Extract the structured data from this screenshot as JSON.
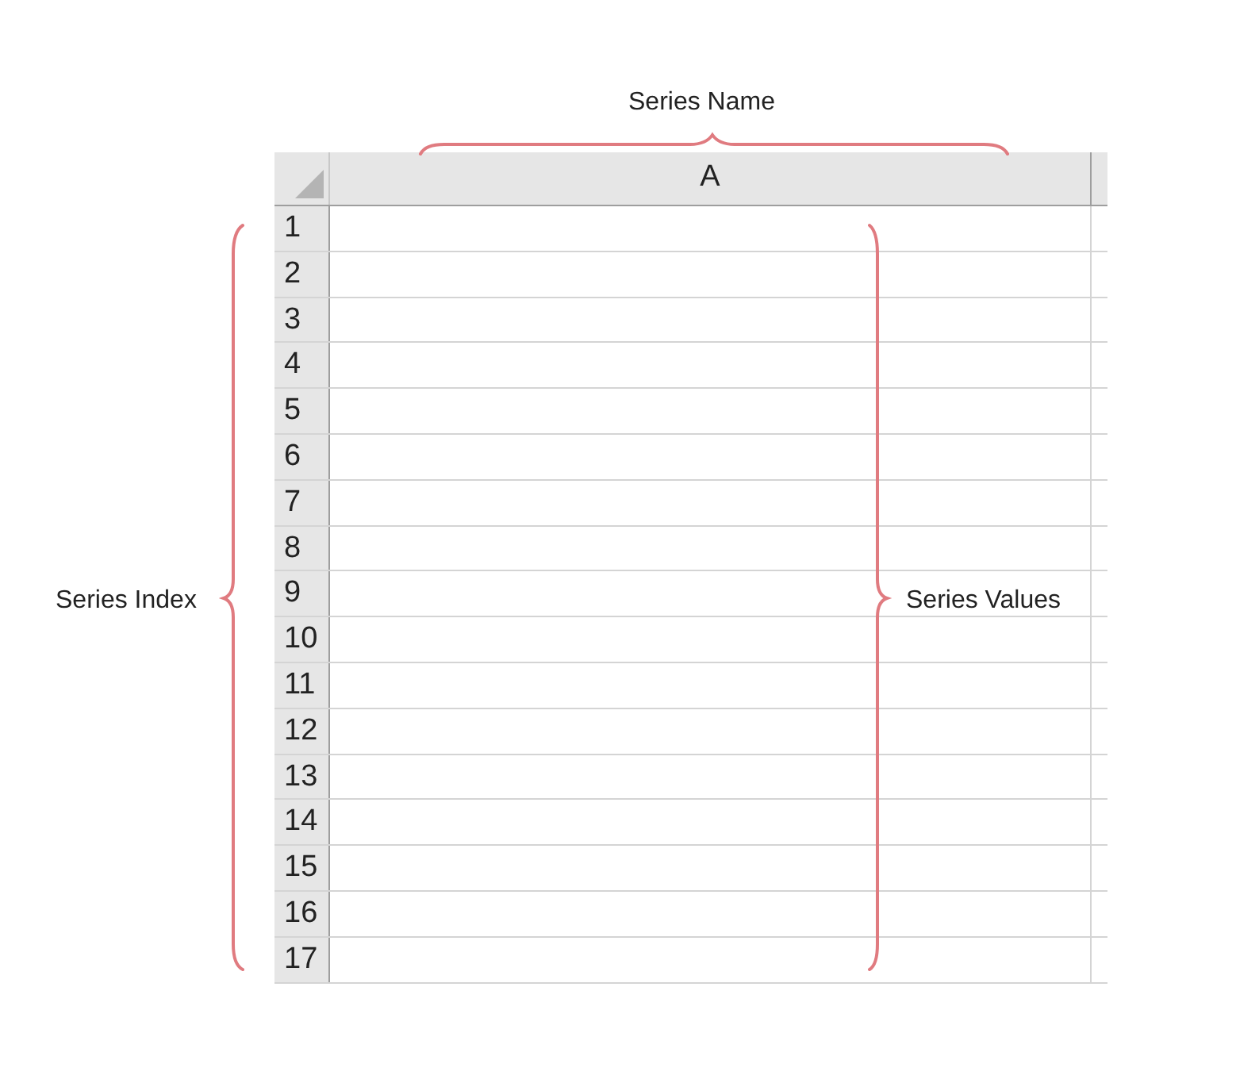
{
  "sheet": {
    "columns": [
      "A"
    ],
    "rows": [
      "1",
      "2",
      "3",
      "4",
      "5",
      "6",
      "7",
      "8",
      "9",
      "10",
      "11",
      "12",
      "13",
      "14",
      "15",
      "16",
      "17"
    ]
  },
  "annotations": [
    {
      "kind": "column",
      "text": "Series Name"
    },
    {
      "kind": "index",
      "text": "Series Index"
    },
    {
      "kind": "values",
      "text": "Series Values"
    }
  ]
}
